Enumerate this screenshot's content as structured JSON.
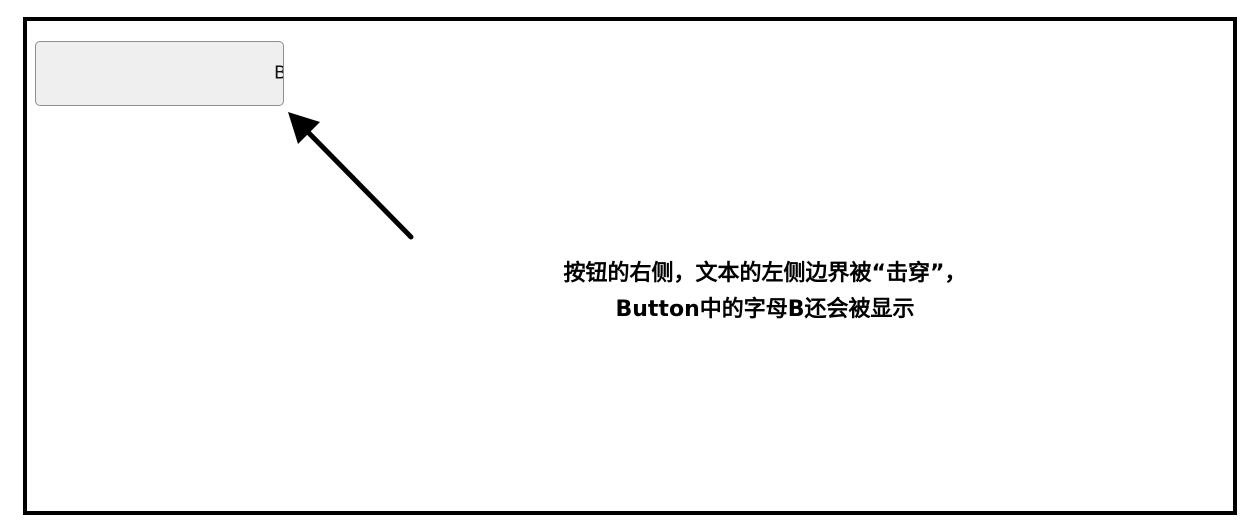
{
  "button": {
    "label": "Button",
    "visible_fragment": "B"
  },
  "annotation": {
    "line1": "按钮的右侧，文本的左侧边界被“击穿”，",
    "line2": "Button中的字母B还会被显示"
  },
  "colors": {
    "frame": "#000000",
    "button_bg": "#efefef",
    "button_border": "#8e8e8e",
    "arrow": "#000000"
  },
  "icons": {
    "pointer_arrow": "arrow-up-left-icon"
  }
}
